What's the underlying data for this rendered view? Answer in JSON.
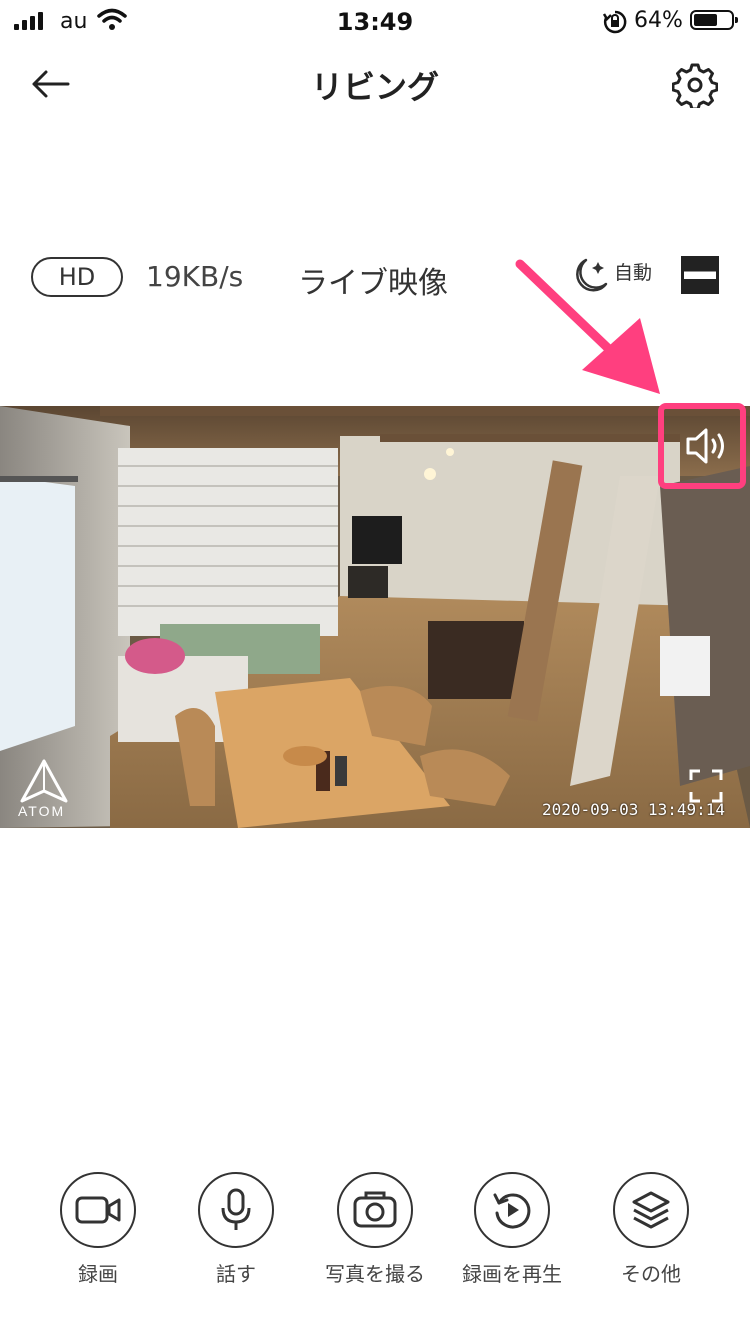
{
  "status_bar": {
    "carrier": "au",
    "time": "13:49",
    "battery_percent": "64%",
    "battery_level": 0.64
  },
  "nav": {
    "title": "リビング",
    "back_icon": "arrow-left-icon",
    "settings_icon": "gear-icon"
  },
  "stream": {
    "quality": "HD",
    "bitrate": "19KB/s",
    "mode_label": "ライブ映像",
    "night_mode": "自動"
  },
  "video": {
    "timestamp": "2020-09-03  13:49:14",
    "logo_text": "ATOM"
  },
  "colors": {
    "highlight": "#ff3f7f",
    "text": "#222222"
  },
  "controls": [
    {
      "label": "録画",
      "icon": "video-camera-icon"
    },
    {
      "label": "話す",
      "icon": "microphone-icon"
    },
    {
      "label": "写真を撮る",
      "icon": "camera-icon"
    },
    {
      "label": "録画を再生",
      "icon": "replay-icon"
    },
    {
      "label": "その他",
      "icon": "layers-icon"
    }
  ]
}
